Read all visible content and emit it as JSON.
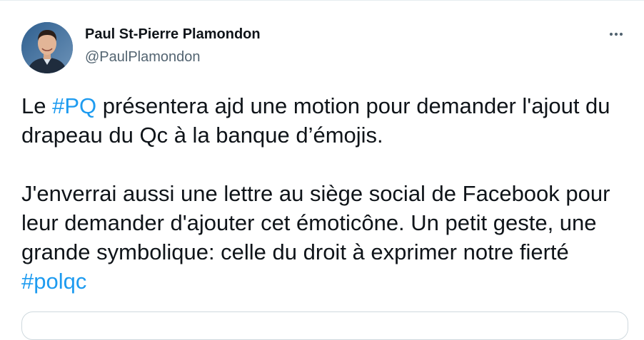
{
  "tweet": {
    "author_name": "Paul St-Pierre Plamondon",
    "author_handle": "@PaulPlamondon",
    "more_icon": "more-horizontal-icon",
    "paragraph1": {
      "before": "Le ",
      "hashtag": "#PQ",
      "after": " présentera ajd une motion pour demander l'ajout du drapeau du Qc à la banque d’émojis."
    },
    "paragraph2": {
      "before": "J'enverrai aussi une lettre au siège social de Facebook pour leur demander d'ajouter cet émoticône. Un petit geste, une grande symbolique: celle du droit à exprimer notre fierté ",
      "hashtag": "#polqc"
    }
  },
  "colors": {
    "link": "#1d9bf0",
    "text": "#0f1419",
    "secondary": "#536471"
  }
}
